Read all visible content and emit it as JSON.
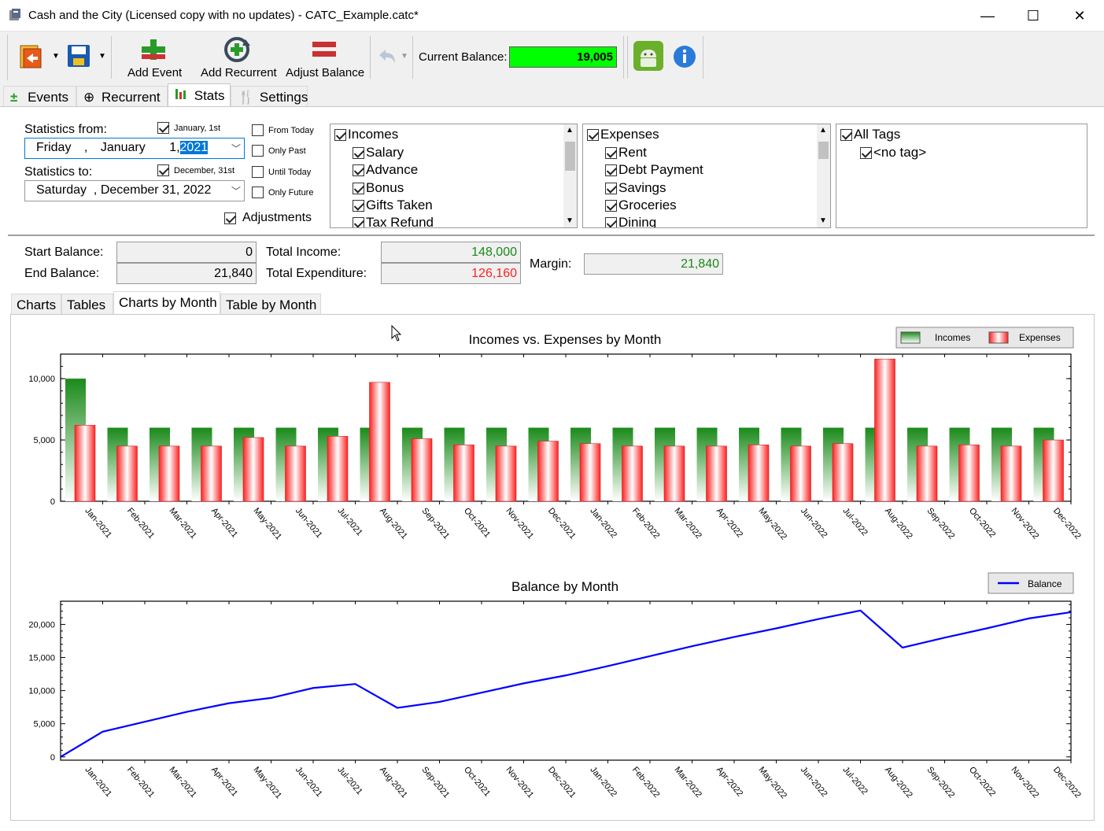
{
  "window": {
    "title": "Cash and the City (Licensed copy with no updates) - CATC_Example.catc*",
    "minimize": "—",
    "maximize": "☐",
    "close": "✕"
  },
  "toolbar": {
    "add_event": "Add Event",
    "add_recurrent": "Add Recurrent",
    "adjust_balance": "Adjust Balance",
    "current_balance_label": "Current Balance:",
    "current_balance_value": "19,005",
    "balance_color": "#00ff00"
  },
  "main_tabs": [
    "Events",
    "Recurrent",
    "Stats",
    "Settings"
  ],
  "filters": {
    "from_label": "Statistics from:",
    "from_quick": "January, 1st",
    "from_day": "Friday",
    "from_sep": ",",
    "from_month": "January",
    "from_daynum": "1,",
    "from_year": "2021",
    "to_label": "Statistics to:",
    "to_quick": "December, 31st",
    "to_value": "Saturday  , December 31, 2022",
    "from_today": "From Today",
    "only_past": "Only Past",
    "until_today": "Until Today",
    "only_future": "Only Future",
    "adjustments": "Adjustments"
  },
  "incomes_list": [
    "Incomes",
    "Salary",
    "Advance",
    "Bonus",
    "Gifts Taken",
    "Tax Refund"
  ],
  "expenses_list": [
    "Expenses",
    "Rent",
    "Debt Payment",
    "Savings",
    "Groceries",
    "Dining"
  ],
  "tags_list": [
    "All Tags",
    "<no tag>"
  ],
  "summary": {
    "start_balance_label": "Start Balance:",
    "start_balance": "0",
    "end_balance_label": "End Balance:",
    "end_balance": "21,840",
    "total_income_label": "Total Income:",
    "total_income": "148,000",
    "total_expenditure_label": "Total Expenditure:",
    "total_expenditure": "126,160",
    "margin_label": "Margin:",
    "margin": "21,840",
    "income_color": "#1a8a1a",
    "expense_color": "#ff2020"
  },
  "sub_tabs": [
    "Charts",
    "Tables",
    "Charts by Month",
    "Table by Month"
  ],
  "chart_data": [
    {
      "type": "bar",
      "title": "Incomes vs. Expenses by Month",
      "categories": [
        "Jan-2021",
        "Feb-2021",
        "Mar-2021",
        "Apr-2021",
        "May-2021",
        "Jun-2021",
        "Jul-2021",
        "Aug-2021",
        "Sep-2021",
        "Oct-2021",
        "Nov-2021",
        "Dec-2021",
        "Jan-2022",
        "Feb-2022",
        "Mar-2022",
        "Apr-2022",
        "May-2022",
        "Jun-2022",
        "Jul-2022",
        "Aug-2022",
        "Sep-2022",
        "Oct-2022",
        "Nov-2022",
        "Dec-2022"
      ],
      "series": [
        {
          "name": "Incomes",
          "color": "#1a8a1a",
          "values": [
            10000,
            6000,
            6000,
            6000,
            6000,
            6000,
            6000,
            6000,
            6000,
            6000,
            6000,
            6000,
            6000,
            6000,
            6000,
            6000,
            6000,
            6000,
            6000,
            6000,
            6000,
            6000,
            6000,
            6000
          ]
        },
        {
          "name": "Expenses",
          "color": "#ff2020",
          "values": [
            6200,
            4500,
            4500,
            4500,
            5200,
            4500,
            5300,
            9700,
            5100,
            4600,
            4500,
            4900,
            4700,
            4500,
            4500,
            4500,
            4600,
            4500,
            4700,
            11600,
            4500,
            4600,
            4500,
            5000
          ]
        }
      ],
      "yticks": [
        "0",
        "5,000",
        "10,000"
      ],
      "ylim": [
        0,
        12000
      ],
      "legend": "top-right"
    },
    {
      "type": "line",
      "title": "Balance by Month",
      "categories": [
        "Jan-2021",
        "Feb-2021",
        "Mar-2021",
        "Apr-2021",
        "May-2021",
        "Jun-2021",
        "Jul-2021",
        "Aug-2021",
        "Sep-2021",
        "Oct-2021",
        "Nov-2021",
        "Dec-2021",
        "Jan-2022",
        "Feb-2022",
        "Mar-2022",
        "Apr-2022",
        "May-2022",
        "Jun-2022",
        "Jul-2022",
        "Aug-2022",
        "Sep-2022",
        "Oct-2022",
        "Nov-2022",
        "Dec-2022"
      ],
      "series": [
        {
          "name": "Balance",
          "color": "#0000ff",
          "values": [
            0,
            3800,
            5300,
            6800,
            8100,
            8900,
            10400,
            11000,
            7400,
            8300,
            9700,
            11100,
            12300,
            13700,
            15200,
            16700,
            18100,
            19400,
            20800,
            22100,
            16500,
            18000,
            19400,
            20900,
            21840
          ]
        }
      ],
      "x_points_note": "",
      "yticks": [
        "0",
        "5,000",
        "10,000",
        "15,000",
        "20,000"
      ],
      "ylim": [
        -500,
        23500
      ],
      "legend": "top-right"
    }
  ]
}
